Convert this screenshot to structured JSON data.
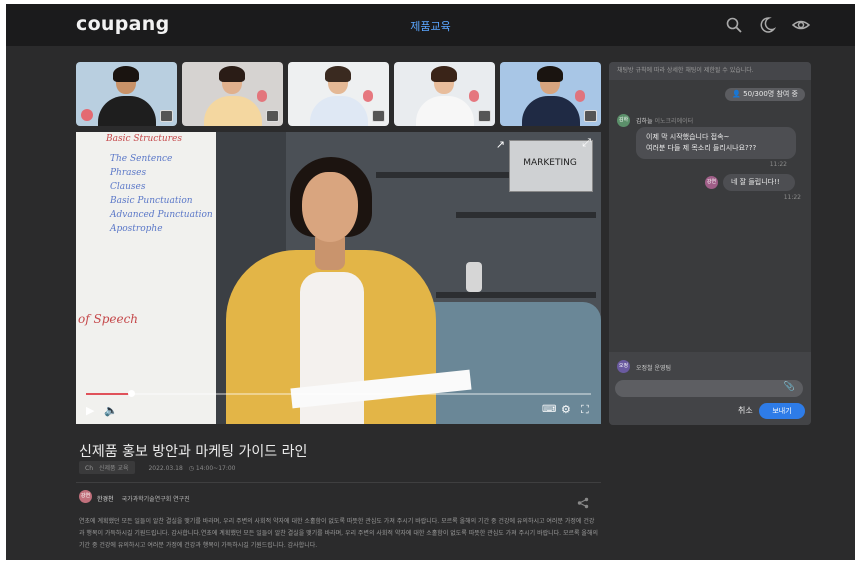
{
  "header": {
    "logo": "coupang",
    "course_title": "제품교육",
    "icons": [
      "search-icon",
      "moon-icon",
      "eye-icon"
    ]
  },
  "participants": [
    {
      "name": "participant-1",
      "mic_muted": true
    },
    {
      "name": "participant-2",
      "mic_muted": true
    },
    {
      "name": "participant-3",
      "mic_muted": true
    },
    {
      "name": "participant-4",
      "mic_muted": true
    },
    {
      "name": "participant-5",
      "mic_muted": true
    }
  ],
  "video": {
    "whiteboard_lines": [
      "Basic Structures",
      "The Sentence",
      "Phrases",
      "Clauses",
      "Basic Punctuation",
      "Advanced Punctuation",
      "Apostrophe",
      "of Speech"
    ],
    "marketing_sign": "MARKETING",
    "progress": 0.09
  },
  "lecture": {
    "title": "신제품 홍보 방안과 마케팅 가이드 라인",
    "category_label": "Ch",
    "category": "신제품 교육",
    "date": "2022.03.18",
    "time": "14:00~17:00"
  },
  "author": {
    "avatar_text": "강연",
    "name": "한경천",
    "org": "국가과학기술연구회 연구진"
  },
  "description": "연초에 계획했던 모든 일들이 알찬 결실을 맺기를 바라며, 우리 주변의 사회적 약자에 대한 소홀함이 없도록 따뜻한 관심도 가져 주시기 바랍니다. 모르록 올해의 기간 중 건강에 유의하시고 여러분 가정에 건강과 행복이 가득하시길 기원드립니다. 감사합니다.연초에 계획했던 모든 일들이 알찬 결실을 맺기를 바라며, 우리 주변의 사회적 약자에 대한 소홀함이 없도록 따뜻한 관심도 가져 주시기 바랍니다. 모르록 올해의 기간 중 건강에 유의하시고 여러분 가정에 건강과 행복이 가득하시길 기원드립니다. 감사합니다.",
  "chat": {
    "notice": "채팅방 규칙에 따라 상세한 채팅이 제한될 수 있습니다.",
    "participant_count": "50/300명 참여 중",
    "messages": [
      {
        "avatar": "김하",
        "sender": "김하늘",
        "role": "이노크리에이터",
        "lines": [
          "이제 막 시작했습니다 접속~",
          "여러분 다들 제 목소리 들리시나요???"
        ],
        "time": "11:22"
      },
      {
        "avatar": "강연",
        "text": "네 잘 들립니다!!",
        "time": "11:22"
      }
    ],
    "me_avatar": "오정",
    "me_name": "오정철 운영팀",
    "cancel_label": "취소",
    "send_label": "보내기",
    "colors": {
      "accent": "#2e7ce8",
      "course_title": "#5aa6ff",
      "mute": "#e46a72"
    }
  }
}
